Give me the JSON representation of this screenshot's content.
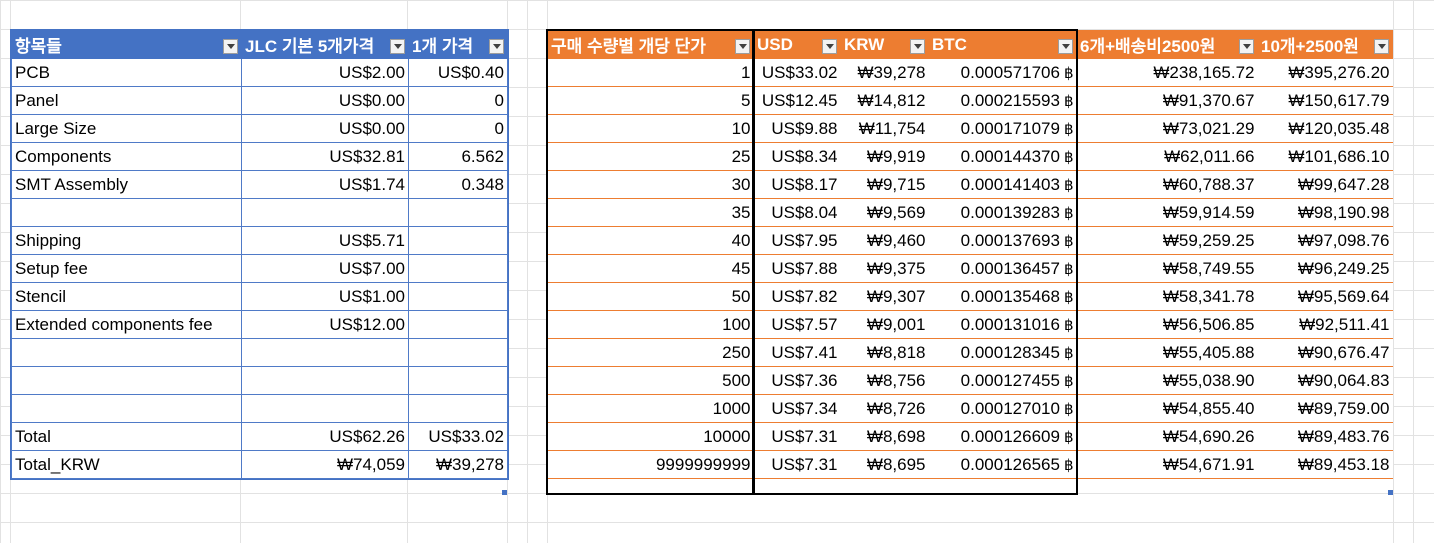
{
  "left_table": {
    "headers": [
      "항목들",
      "JLC 기본 5개가격",
      "1개 가격"
    ],
    "rows": [
      [
        "PCB",
        "US$2.00",
        "US$0.40"
      ],
      [
        "Panel",
        "US$0.00",
        "0"
      ],
      [
        "Large Size",
        "US$0.00",
        "0"
      ],
      [
        "Components",
        "US$32.81",
        "6.562"
      ],
      [
        "SMT Assembly",
        "US$1.74",
        "0.348"
      ],
      [
        "",
        "",
        ""
      ],
      [
        "Shipping",
        "US$5.71",
        ""
      ],
      [
        "Setup fee",
        "US$7.00",
        ""
      ],
      [
        "Stencil",
        "US$1.00",
        ""
      ],
      [
        "Extended components fee",
        "US$12.00",
        ""
      ],
      [
        "",
        "",
        ""
      ],
      [
        "",
        "",
        ""
      ],
      [
        "",
        "",
        ""
      ],
      [
        "Total",
        "US$62.26",
        "US$33.02"
      ],
      [
        "Total_KRW",
        "₩74,059",
        "₩39,278"
      ]
    ]
  },
  "right_table": {
    "headers": [
      "구매 수량별 개당 단가",
      "USD",
      "KRW",
      "BTC",
      "6개+배송비2500원",
      "10개+2500원"
    ],
    "btc_symbol": "฿",
    "rows": [
      [
        "1",
        "US$33.02",
        "₩39,278",
        "0.000571706",
        "₩238,165.72",
        "₩395,276.20"
      ],
      [
        "5",
        "US$12.45",
        "₩14,812",
        "0.000215593",
        "₩91,370.67",
        "₩150,617.79"
      ],
      [
        "10",
        "US$9.88",
        "₩11,754",
        "0.000171079",
        "₩73,021.29",
        "₩120,035.48"
      ],
      [
        "25",
        "US$8.34",
        "₩9,919",
        "0.000144370",
        "₩62,011.66",
        "₩101,686.10"
      ],
      [
        "30",
        "US$8.17",
        "₩9,715",
        "0.000141403",
        "₩60,788.37",
        "₩99,647.28"
      ],
      [
        "35",
        "US$8.04",
        "₩9,569",
        "0.000139283",
        "₩59,914.59",
        "₩98,190.98"
      ],
      [
        "40",
        "US$7.95",
        "₩9,460",
        "0.000137693",
        "₩59,259.25",
        "₩97,098.76"
      ],
      [
        "45",
        "US$7.88",
        "₩9,375",
        "0.000136457",
        "₩58,749.55",
        "₩96,249.25"
      ],
      [
        "50",
        "US$7.82",
        "₩9,307",
        "0.000135468",
        "₩58,341.78",
        "₩95,569.64"
      ],
      [
        "100",
        "US$7.57",
        "₩9,001",
        "0.000131016",
        "₩56,506.85",
        "₩92,511.41"
      ],
      [
        "250",
        "US$7.41",
        "₩8,818",
        "0.000128345",
        "₩55,405.88",
        "₩90,676.47"
      ],
      [
        "500",
        "US$7.36",
        "₩8,756",
        "0.000127455",
        "₩55,038.90",
        "₩90,064.83"
      ],
      [
        "1000",
        "US$7.34",
        "₩8,726",
        "0.000127010",
        "₩54,855.40",
        "₩89,759.00"
      ],
      [
        "10000",
        "US$7.31",
        "₩8,698",
        "0.000126609",
        "₩54,690.26",
        "₩89,483.76"
      ],
      [
        "9999999999",
        "US$7.31",
        "₩8,695",
        "0.000126565",
        "₩54,671.91",
        "₩89,453.18"
      ]
    ]
  },
  "colors": {
    "blue_header": "#4472c4",
    "orange_header": "#ed7d31",
    "gridline": "#e2e2e2"
  }
}
